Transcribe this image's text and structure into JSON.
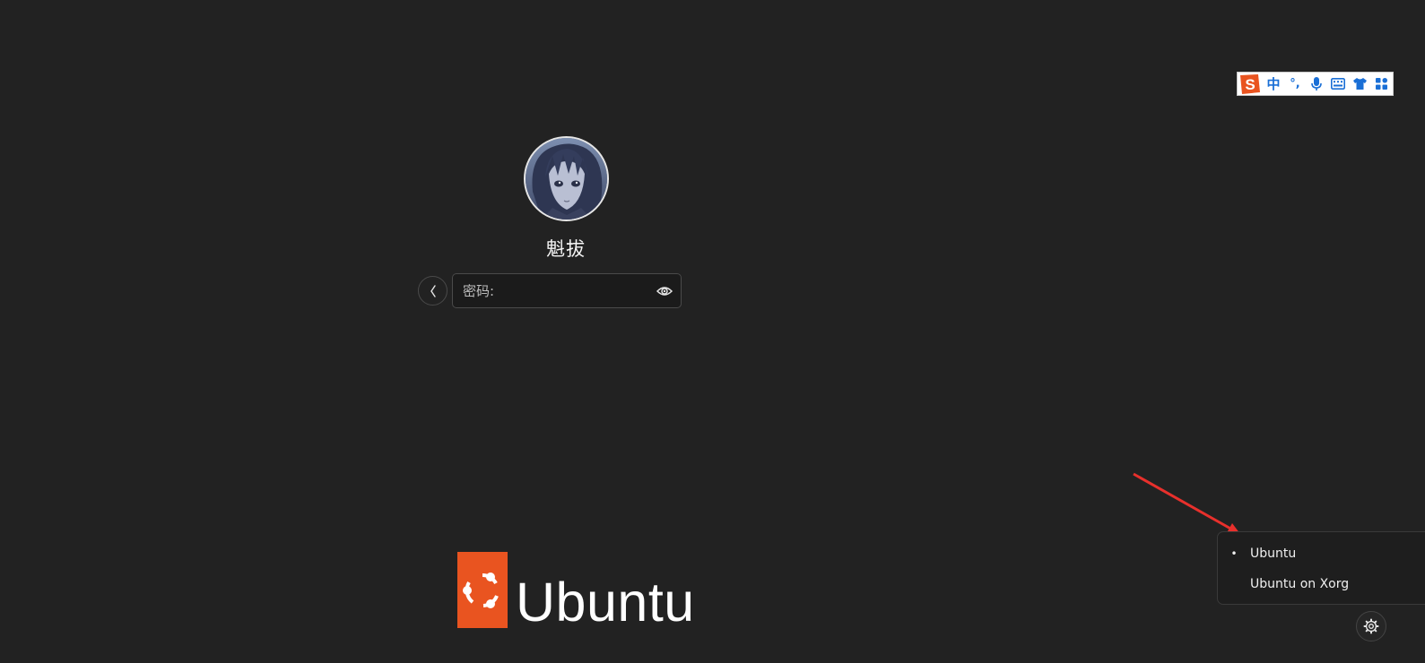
{
  "ime_toolbar": {
    "logo_letter": "S",
    "chinese_mode_label": "中",
    "punctuation_label": "°,",
    "icons": [
      "sogou-logo-icon",
      "microphone-icon",
      "keyboard-icon",
      "tshirt-skin-icon",
      "grid-apps-icon"
    ],
    "brand_color": "#e95420",
    "icon_color": "#1a6fd6"
  },
  "login": {
    "user_name": "魁拔",
    "password_placeholder": "密码:",
    "password_value": ""
  },
  "branding": {
    "wordmark": "Ubuntu",
    "brand_color": "#e95420"
  },
  "session_menu": {
    "items": [
      {
        "label": "Ubuntu",
        "selected": true,
        "marker": "•"
      },
      {
        "label": "Ubuntu on Xorg",
        "selected": false,
        "marker": ""
      }
    ]
  },
  "colors": {
    "background": "#222222",
    "annotation_arrow": "#e8302c"
  }
}
